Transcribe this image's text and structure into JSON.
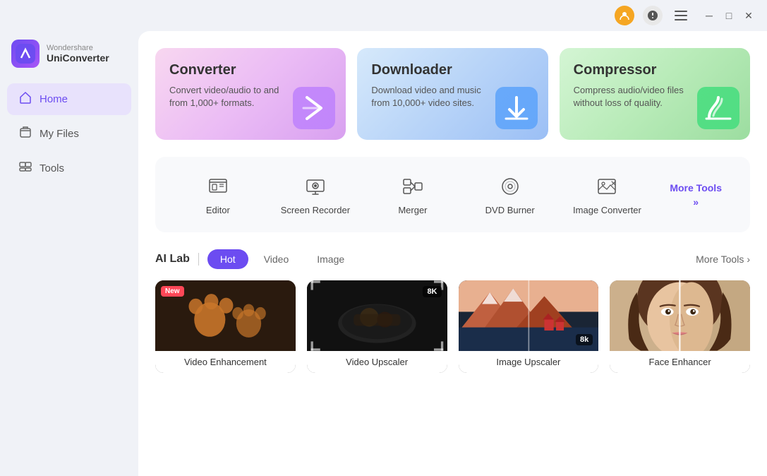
{
  "titleBar": {
    "minimize": "─",
    "maximize": "□",
    "close": "✕"
  },
  "logo": {
    "brand": "Wondershare",
    "product": "UniConverter"
  },
  "sidebar": {
    "items": [
      {
        "id": "home",
        "label": "Home",
        "icon": "🏠",
        "active": true
      },
      {
        "id": "my-files",
        "label": "My Files",
        "icon": "📁",
        "active": false
      },
      {
        "id": "tools",
        "label": "Tools",
        "icon": "🔧",
        "active": false
      }
    ]
  },
  "featureCards": [
    {
      "id": "converter",
      "title": "Converter",
      "description": "Convert video/audio to and from 1,000+ formats.",
      "theme": "converter"
    },
    {
      "id": "downloader",
      "title": "Downloader",
      "description": "Download video and music from 10,000+ video sites.",
      "theme": "downloader"
    },
    {
      "id": "compressor",
      "title": "Compressor",
      "description": "Compress audio/video files without loss of quality.",
      "theme": "compressor"
    }
  ],
  "tools": [
    {
      "id": "editor",
      "label": "Editor"
    },
    {
      "id": "screen-recorder",
      "label": "Screen Recorder"
    },
    {
      "id": "merger",
      "label": "Merger"
    },
    {
      "id": "dvd-burner",
      "label": "DVD Burner"
    },
    {
      "id": "image-converter",
      "label": "Image Converter"
    }
  ],
  "toolsMore": "More Tools",
  "aiLab": {
    "title": "AI Lab",
    "tabs": [
      {
        "id": "hot",
        "label": "Hot",
        "active": true
      },
      {
        "id": "video",
        "label": "Video",
        "active": false
      },
      {
        "id": "image",
        "label": "Image",
        "active": false
      }
    ],
    "moreTools": "More Tools",
    "cards": [
      {
        "id": "video-enhancement",
        "label": "Video Enhancement",
        "badgeNew": true,
        "badge8k": false
      },
      {
        "id": "video-upscaler",
        "label": "Video Upscaler",
        "badgeNew": false,
        "badge8k": true
      },
      {
        "id": "image-upscaler",
        "label": "Image Upscaler",
        "badgeNew": false,
        "badge8k": true
      },
      {
        "id": "face-enhancer",
        "label": "Face Enhancer",
        "badgeNew": false,
        "badge8k": false
      }
    ]
  }
}
